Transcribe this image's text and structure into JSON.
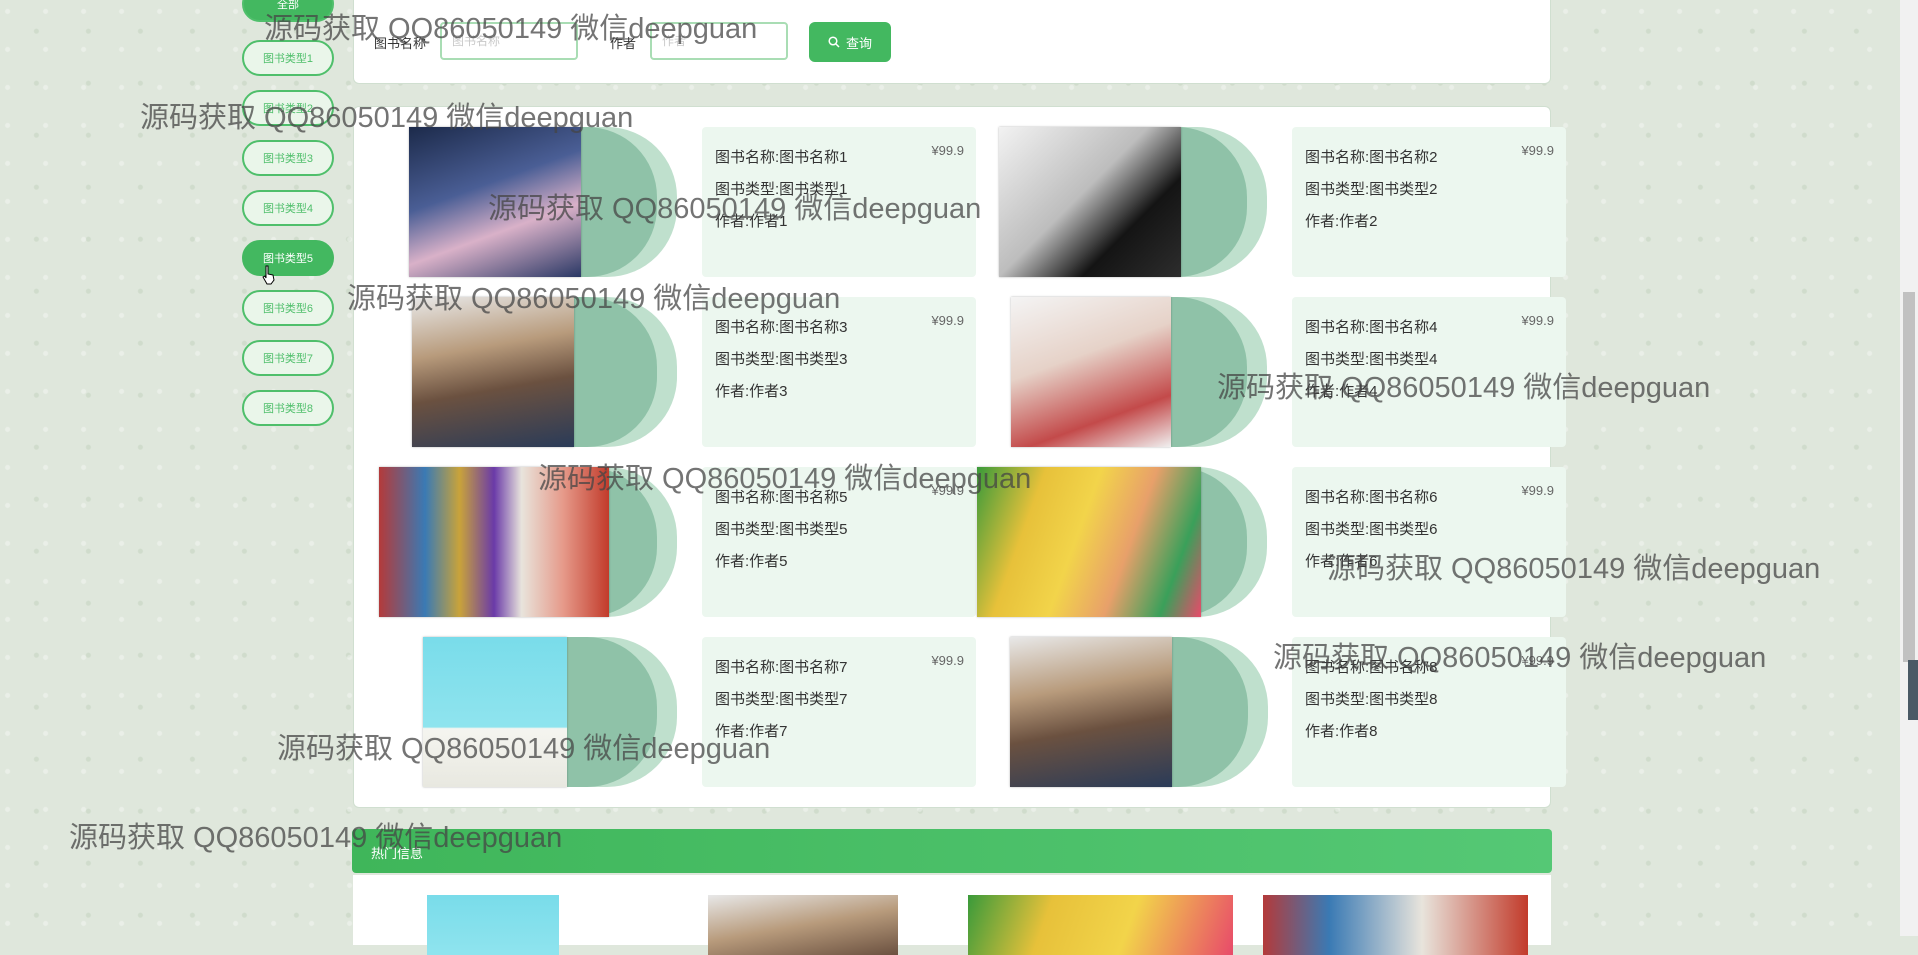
{
  "sidebar": {
    "top_label": "全部",
    "items": [
      "图书类型1",
      "图书类型2",
      "图书类型3",
      "图书类型4",
      "图书类型5",
      "图书类型6",
      "图书类型7",
      "图书类型8"
    ],
    "active_index": 4
  },
  "search": {
    "name_label": "图书名称",
    "name_placeholder": "图书名称",
    "author_label": "作者",
    "author_placeholder": "作者",
    "query_label": "查询"
  },
  "books": [
    {
      "name": "图书名称:图书名称1",
      "type": "图书类型:图书类型1",
      "author": "作者:作者1",
      "price": "¥99.9"
    },
    {
      "name": "图书名称:图书名称2",
      "type": "图书类型:图书类型2",
      "author": "作者:作者2",
      "price": "¥99.9"
    },
    {
      "name": "图书名称:图书名称3",
      "type": "图书类型:图书类型3",
      "author": "作者:作者3",
      "price": "¥99.9"
    },
    {
      "name": "图书名称:图书名称4",
      "type": "图书类型:图书类型4",
      "author": "作者:作者4",
      "price": "¥99.9"
    },
    {
      "name": "图书名称:图书名称5",
      "type": "图书类型:图书类型5",
      "author": "作者:作者5",
      "price": "¥99.9"
    },
    {
      "name": "图书名称:图书名称6",
      "type": "图书类型:图书类型6",
      "author": "作者:作者6",
      "price": "¥99.9"
    },
    {
      "name": "图书名称:图书名称7",
      "type": "图书类型:图书类型7",
      "author": "作者:作者7",
      "price": "¥99.9"
    },
    {
      "name": "图书名称:图书名称8",
      "type": "图书类型:图书类型8",
      "author": "作者:作者8",
      "price": "¥99.9"
    }
  ],
  "hot": {
    "title": "热门信息"
  },
  "watermark": "源码获取 QQ86050149 微信deepguan",
  "colors": {
    "accent": "#43b860",
    "card_bg": "#ecf7ef"
  }
}
